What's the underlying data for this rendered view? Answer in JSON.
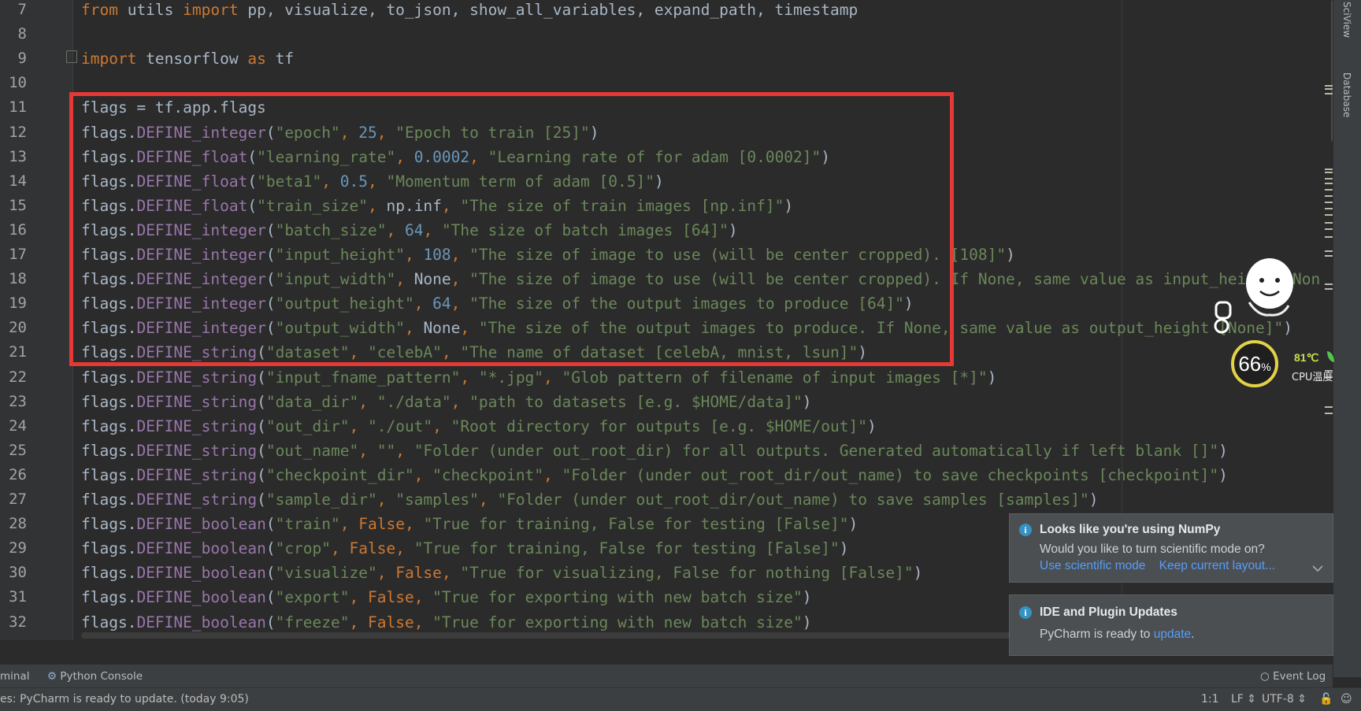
{
  "editor": {
    "lines": [
      {
        "num": "7",
        "tokens": [
          {
            "t": "from ",
            "c": "kw"
          },
          {
            "t": "utils ",
            "c": "default"
          },
          {
            "t": "import ",
            "c": "kw"
          },
          {
            "t": "pp, visualize, to_json, show_all_variables, expand_path, timestamp",
            "c": "default"
          }
        ]
      },
      {
        "num": "8",
        "tokens": []
      },
      {
        "num": "9",
        "tokens": [
          {
            "t": "import ",
            "c": "kw"
          },
          {
            "t": "tensorflow ",
            "c": "default"
          },
          {
            "t": "as ",
            "c": "kw"
          },
          {
            "t": "tf",
            "c": "default"
          }
        ]
      },
      {
        "num": "10",
        "tokens": []
      },
      {
        "num": "11",
        "tokens": [
          {
            "t": "flags = tf.app.flags",
            "c": "default"
          }
        ]
      },
      {
        "num": "12",
        "tokens": [
          {
            "t": "flags.",
            "c": "default"
          },
          {
            "t": "DEFINE_integer",
            "c": "fn"
          },
          {
            "t": "(",
            "c": "default"
          },
          {
            "t": "\"epoch\"",
            "c": "str"
          },
          {
            "t": ", ",
            "c": "kw"
          },
          {
            "t": "25",
            "c": "num"
          },
          {
            "t": ", ",
            "c": "kw"
          },
          {
            "t": "\"Epoch to train [25]\"",
            "c": "str"
          },
          {
            "t": ")",
            "c": "default"
          }
        ]
      },
      {
        "num": "13",
        "tokens": [
          {
            "t": "flags.",
            "c": "default"
          },
          {
            "t": "DEFINE_float",
            "c": "fn"
          },
          {
            "t": "(",
            "c": "default"
          },
          {
            "t": "\"learning_rate\"",
            "c": "str"
          },
          {
            "t": ", ",
            "c": "kw"
          },
          {
            "t": "0.0002",
            "c": "num"
          },
          {
            "t": ", ",
            "c": "kw"
          },
          {
            "t": "\"Learning rate of for adam [0.0002]\"",
            "c": "str"
          },
          {
            "t": ")",
            "c": "default"
          }
        ]
      },
      {
        "num": "14",
        "tokens": [
          {
            "t": "flags.",
            "c": "default"
          },
          {
            "t": "DEFINE_float",
            "c": "fn"
          },
          {
            "t": "(",
            "c": "default"
          },
          {
            "t": "\"beta1\"",
            "c": "str"
          },
          {
            "t": ", ",
            "c": "kw"
          },
          {
            "t": "0.5",
            "c": "num"
          },
          {
            "t": ", ",
            "c": "kw"
          },
          {
            "t": "\"Momentum term of adam [0.5]\"",
            "c": "str"
          },
          {
            "t": ")",
            "c": "default"
          }
        ]
      },
      {
        "num": "15",
        "tokens": [
          {
            "t": "flags.",
            "c": "default"
          },
          {
            "t": "DEFINE_float",
            "c": "fn"
          },
          {
            "t": "(",
            "c": "default"
          },
          {
            "t": "\"train_size\"",
            "c": "str"
          },
          {
            "t": ", ",
            "c": "kw"
          },
          {
            "t": "np.inf",
            "c": "default"
          },
          {
            "t": ", ",
            "c": "kw"
          },
          {
            "t": "\"The size of train images [np.inf]\"",
            "c": "str"
          },
          {
            "t": ")",
            "c": "default"
          }
        ]
      },
      {
        "num": "16",
        "tokens": [
          {
            "t": "flags.",
            "c": "default"
          },
          {
            "t": "DEFINE_integer",
            "c": "fn"
          },
          {
            "t": "(",
            "c": "default"
          },
          {
            "t": "\"batch_size\"",
            "c": "str"
          },
          {
            "t": ", ",
            "c": "kw"
          },
          {
            "t": "64",
            "c": "num"
          },
          {
            "t": ", ",
            "c": "kw"
          },
          {
            "t": "\"The size of batch images [64]\"",
            "c": "str"
          },
          {
            "t": ")",
            "c": "default"
          }
        ]
      },
      {
        "num": "17",
        "tokens": [
          {
            "t": "flags.",
            "c": "default"
          },
          {
            "t": "DEFINE_integer",
            "c": "fn"
          },
          {
            "t": "(",
            "c": "default"
          },
          {
            "t": "\"input_height\"",
            "c": "str"
          },
          {
            "t": ", ",
            "c": "kw"
          },
          {
            "t": "108",
            "c": "num"
          },
          {
            "t": ", ",
            "c": "kw"
          },
          {
            "t": "\"The size of image to use (will be center cropped). [108]\"",
            "c": "str"
          },
          {
            "t": ")",
            "c": "default"
          }
        ]
      },
      {
        "num": "18",
        "tokens": [
          {
            "t": "flags.",
            "c": "default"
          },
          {
            "t": "DEFINE_integer",
            "c": "fn"
          },
          {
            "t": "(",
            "c": "default"
          },
          {
            "t": "\"input_width\"",
            "c": "str"
          },
          {
            "t": ", ",
            "c": "kw"
          },
          {
            "t": "None",
            "c": "default"
          },
          {
            "t": ", ",
            "c": "kw"
          },
          {
            "t": "\"The size of image to use (will be center cropped). If None, same value as input_height [Non",
            "c": "str"
          }
        ]
      },
      {
        "num": "19",
        "tokens": [
          {
            "t": "flags.",
            "c": "default"
          },
          {
            "t": "DEFINE_integer",
            "c": "fn"
          },
          {
            "t": "(",
            "c": "default"
          },
          {
            "t": "\"output_height\"",
            "c": "str"
          },
          {
            "t": ", ",
            "c": "kw"
          },
          {
            "t": "64",
            "c": "num"
          },
          {
            "t": ", ",
            "c": "kw"
          },
          {
            "t": "\"The size of the output images to produce [64]\"",
            "c": "str"
          },
          {
            "t": ")",
            "c": "default"
          }
        ]
      },
      {
        "num": "20",
        "tokens": [
          {
            "t": "flags.",
            "c": "default"
          },
          {
            "t": "DEFINE_integer",
            "c": "fn"
          },
          {
            "t": "(",
            "c": "default"
          },
          {
            "t": "\"output_width\"",
            "c": "str"
          },
          {
            "t": ", ",
            "c": "kw"
          },
          {
            "t": "None",
            "c": "default"
          },
          {
            "t": ", ",
            "c": "kw"
          },
          {
            "t": "\"The size of the output images to produce. If None, same value as output_height [None]\"",
            "c": "str"
          },
          {
            "t": ")",
            "c": "default"
          }
        ]
      },
      {
        "num": "21",
        "tokens": [
          {
            "t": "flags.",
            "c": "default"
          },
          {
            "t": "DEFINE_string",
            "c": "fn"
          },
          {
            "t": "(",
            "c": "default"
          },
          {
            "t": "\"dataset\"",
            "c": "str"
          },
          {
            "t": ", ",
            "c": "kw"
          },
          {
            "t": "\"celebA\"",
            "c": "str"
          },
          {
            "t": ", ",
            "c": "kw"
          },
          {
            "t": "\"The name of dataset [celebA, mnist, lsun]\"",
            "c": "str"
          },
          {
            "t": ")",
            "c": "default"
          }
        ]
      },
      {
        "num": "22",
        "tokens": [
          {
            "t": "flags.",
            "c": "default"
          },
          {
            "t": "DEFINE_string",
            "c": "fn"
          },
          {
            "t": "(",
            "c": "default"
          },
          {
            "t": "\"input_fname_pattern\"",
            "c": "str"
          },
          {
            "t": ", ",
            "c": "kw"
          },
          {
            "t": "\"*.jpg\"",
            "c": "str"
          },
          {
            "t": ", ",
            "c": "kw"
          },
          {
            "t": "\"Glob pattern of filename of input images [*]\"",
            "c": "str"
          },
          {
            "t": ")",
            "c": "default"
          }
        ]
      },
      {
        "num": "23",
        "tokens": [
          {
            "t": "flags.",
            "c": "default"
          },
          {
            "t": "DEFINE_string",
            "c": "fn"
          },
          {
            "t": "(",
            "c": "default"
          },
          {
            "t": "\"data_dir\"",
            "c": "str"
          },
          {
            "t": ", ",
            "c": "kw"
          },
          {
            "t": "\"./data\"",
            "c": "str"
          },
          {
            "t": ", ",
            "c": "kw"
          },
          {
            "t": "\"path to datasets [e.g. $HOME/data]\"",
            "c": "str"
          },
          {
            "t": ")",
            "c": "default"
          }
        ]
      },
      {
        "num": "24",
        "tokens": [
          {
            "t": "flags.",
            "c": "default"
          },
          {
            "t": "DEFINE_string",
            "c": "fn"
          },
          {
            "t": "(",
            "c": "default"
          },
          {
            "t": "\"out_dir\"",
            "c": "str"
          },
          {
            "t": ", ",
            "c": "kw"
          },
          {
            "t": "\"./out\"",
            "c": "str"
          },
          {
            "t": ", ",
            "c": "kw"
          },
          {
            "t": "\"Root directory for outputs [e.g. $HOME/out]\"",
            "c": "str"
          },
          {
            "t": ")",
            "c": "default"
          }
        ]
      },
      {
        "num": "25",
        "tokens": [
          {
            "t": "flags.",
            "c": "default"
          },
          {
            "t": "DEFINE_string",
            "c": "fn"
          },
          {
            "t": "(",
            "c": "default"
          },
          {
            "t": "\"out_name\"",
            "c": "str"
          },
          {
            "t": ", ",
            "c": "kw"
          },
          {
            "t": "\"\"",
            "c": "str"
          },
          {
            "t": ", ",
            "c": "kw"
          },
          {
            "t": "\"Folder (under out_root_dir) for all outputs. Generated automatically if left blank []\"",
            "c": "str"
          },
          {
            "t": ")",
            "c": "default"
          }
        ]
      },
      {
        "num": "26",
        "tokens": [
          {
            "t": "flags.",
            "c": "default"
          },
          {
            "t": "DEFINE_string",
            "c": "fn"
          },
          {
            "t": "(",
            "c": "default"
          },
          {
            "t": "\"checkpoint_dir\"",
            "c": "str"
          },
          {
            "t": ", ",
            "c": "kw"
          },
          {
            "t": "\"checkpoint\"",
            "c": "str"
          },
          {
            "t": ", ",
            "c": "kw"
          },
          {
            "t": "\"Folder (under out_root_dir/out_name) to save checkpoints [checkpoint]\"",
            "c": "str"
          },
          {
            "t": ")",
            "c": "default"
          }
        ]
      },
      {
        "num": "27",
        "tokens": [
          {
            "t": "flags.",
            "c": "default"
          },
          {
            "t": "DEFINE_string",
            "c": "fn"
          },
          {
            "t": "(",
            "c": "default"
          },
          {
            "t": "\"sample_dir\"",
            "c": "str"
          },
          {
            "t": ", ",
            "c": "kw"
          },
          {
            "t": "\"samples\"",
            "c": "str"
          },
          {
            "t": ", ",
            "c": "kw"
          },
          {
            "t": "\"Folder (under out_root_dir/out_name) to save samples [samples]\"",
            "c": "str"
          },
          {
            "t": ")",
            "c": "default"
          }
        ]
      },
      {
        "num": "28",
        "tokens": [
          {
            "t": "flags.",
            "c": "default"
          },
          {
            "t": "DEFINE_boolean",
            "c": "fn"
          },
          {
            "t": "(",
            "c": "default"
          },
          {
            "t": "\"train\"",
            "c": "str"
          },
          {
            "t": ", ",
            "c": "kw"
          },
          {
            "t": "False",
            "c": "kw"
          },
          {
            "t": ", ",
            "c": "kw"
          },
          {
            "t": "\"True for training, False for testing [False]\"",
            "c": "str"
          },
          {
            "t": ")",
            "c": "default"
          }
        ]
      },
      {
        "num": "29",
        "tokens": [
          {
            "t": "flags.",
            "c": "default"
          },
          {
            "t": "DEFINE_boolean",
            "c": "fn"
          },
          {
            "t": "(",
            "c": "default"
          },
          {
            "t": "\"crop\"",
            "c": "str"
          },
          {
            "t": ", ",
            "c": "kw"
          },
          {
            "t": "False",
            "c": "kw"
          },
          {
            "t": ", ",
            "c": "kw"
          },
          {
            "t": "\"True for training, False for testing [False]\"",
            "c": "str"
          },
          {
            "t": ")",
            "c": "default"
          }
        ]
      },
      {
        "num": "30",
        "tokens": [
          {
            "t": "flags.",
            "c": "default"
          },
          {
            "t": "DEFINE_boolean",
            "c": "fn"
          },
          {
            "t": "(",
            "c": "default"
          },
          {
            "t": "\"visualize\"",
            "c": "str"
          },
          {
            "t": ", ",
            "c": "kw"
          },
          {
            "t": "False",
            "c": "kw"
          },
          {
            "t": ", ",
            "c": "kw"
          },
          {
            "t": "\"True for visualizing, False for nothing [False]\"",
            "c": "str"
          },
          {
            "t": ")",
            "c": "default"
          }
        ]
      },
      {
        "num": "31",
        "tokens": [
          {
            "t": "flags.",
            "c": "default"
          },
          {
            "t": "DEFINE_boolean",
            "c": "fn"
          },
          {
            "t": "(",
            "c": "default"
          },
          {
            "t": "\"export\"",
            "c": "str"
          },
          {
            "t": ", ",
            "c": "kw"
          },
          {
            "t": "False",
            "c": "kw"
          },
          {
            "t": ", ",
            "c": "kw"
          },
          {
            "t": "\"True for exporting with new batch size\"",
            "c": "str"
          },
          {
            "t": ")",
            "c": "default"
          }
        ]
      },
      {
        "num": "32",
        "tokens": [
          {
            "t": "flags.",
            "c": "default"
          },
          {
            "t": "DEFINE_boolean",
            "c": "fn"
          },
          {
            "t": "(",
            "c": "default"
          },
          {
            "t": "\"freeze\"",
            "c": "str"
          },
          {
            "t": ", ",
            "c": "kw"
          },
          {
            "t": "False",
            "c": "kw"
          },
          {
            "t": ", ",
            "c": "kw"
          },
          {
            "t": "\"True for exporting with new batch size\"",
            "c": "str"
          },
          {
            "t": ")",
            "c": "default"
          }
        ]
      }
    ]
  },
  "right_strip": {
    "sciview_label": "SciView",
    "database_label": "Database"
  },
  "notifications": {
    "numpy": {
      "title": "Looks like you're using NumPy",
      "text": "Would you like to turn scientific mode on?",
      "link1": "Use scientific mode",
      "link2": "Keep current layout..."
    },
    "updates": {
      "title": "IDE and Plugin Updates",
      "text_prefix": "PyCharm is ready to ",
      "link": "update",
      "text_suffix": "."
    }
  },
  "cpu_widget": {
    "percent": "66",
    "percent_unit": "%",
    "temp": "81℃",
    "label": "CPU温度"
  },
  "toolwindows": {
    "terminal": "minal",
    "python_console": "Python Console",
    "event_log": "Event Log"
  },
  "status_bar": {
    "message": "es: PyCharm is ready to update. (today 9:05)",
    "position": "1:1",
    "line_sep": "LF ⇕",
    "encoding": "UTF-8 ⇕"
  },
  "colors": {
    "highlight_box": "#e53935",
    "link": "#589df6"
  }
}
